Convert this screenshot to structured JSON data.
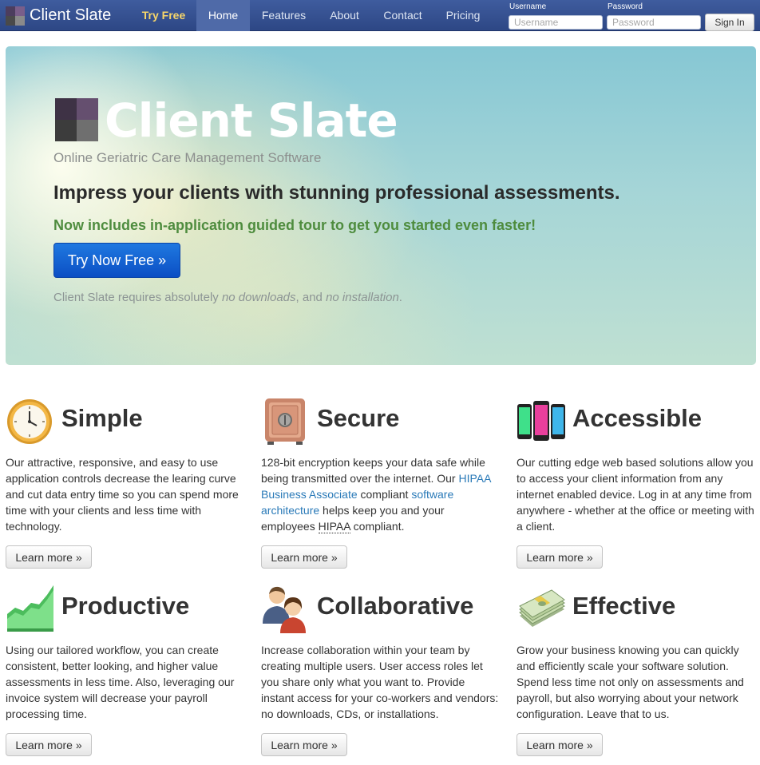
{
  "navbar": {
    "brand": "Client Slate",
    "items": [
      {
        "label": "Try Free"
      },
      {
        "label": "Home"
      },
      {
        "label": "Features"
      },
      {
        "label": "About"
      },
      {
        "label": "Contact"
      },
      {
        "label": "Pricing"
      }
    ],
    "active_item": "Home",
    "login": {
      "username_label": "Username",
      "username_placeholder": "Username",
      "password_label": "Password",
      "password_placeholder": "Password",
      "signin_label": "Sign In"
    }
  },
  "hero": {
    "title": "Client Slate",
    "subtitle": "Online Geriatric Care Management Software",
    "headline": "Impress your clients with stunning professional assessments.",
    "tagline": "Now includes in-application guided tour to get you started even faster!",
    "cta_label": "Try Now Free »",
    "note": {
      "prefix": "Client Slate requires absolutely ",
      "em1": "no downloads",
      "mid": ", and ",
      "em2": "no installation",
      "suffix": "."
    }
  },
  "features": [
    {
      "icon": "clock-icon",
      "title": "Simple",
      "text": "Our attractive, responsive, and easy to use application controls decrease the learing curve and cut data entry time so you can spend more time with your clients and less time with technology.",
      "button": "Learn more »"
    },
    {
      "icon": "safe-icon",
      "title": "Secure",
      "text_parts": {
        "p1": "128-bit encryption keeps your data safe while being transmitted over the internet. Our ",
        "link1": "HIPAA Business Associate",
        "p2": " compliant ",
        "link2": "software architecture",
        "p3": " helps keep you and your employees ",
        "abbr": "HIPAA",
        "p4": " compliant."
      },
      "button": "Learn more »"
    },
    {
      "icon": "phones-icon",
      "title": "Accessible",
      "text": "Our cutting edge web based solutions allow you to access your client information from any internet enabled device. Log in at any time from anywhere - whether at the office or meeting with a client.",
      "button": "Learn more »"
    },
    {
      "icon": "chart-icon",
      "title": "Productive",
      "text": "Using our tailored workflow, you can create consistent, better looking, and higher value assessments in less time. Also, leveraging our invoice system will decrease your payroll processing time.",
      "button": "Learn more »"
    },
    {
      "icon": "users-icon",
      "title": "Collaborative",
      "text": "Increase collaboration within your team by creating multiple users. User access roles let you share only what you want to. Provide instant access for your co-workers and vendors: no downloads, CDs, or installations.",
      "button": "Learn more »"
    },
    {
      "icon": "money-icon",
      "title": "Effective",
      "text": "Grow your business knowing you can quickly and efficiently scale your software solution. Spend less time not only on assessments and payroll, but also worrying about your network configuration. Leave that to us.",
      "button": "Learn more »"
    }
  ],
  "colors": {
    "navbar": "#2d4785",
    "accent_try_free": "#f7d66a",
    "cta": "#0b4fc4",
    "tagline": "#4e8c3e",
    "link": "#2a7ab8"
  }
}
